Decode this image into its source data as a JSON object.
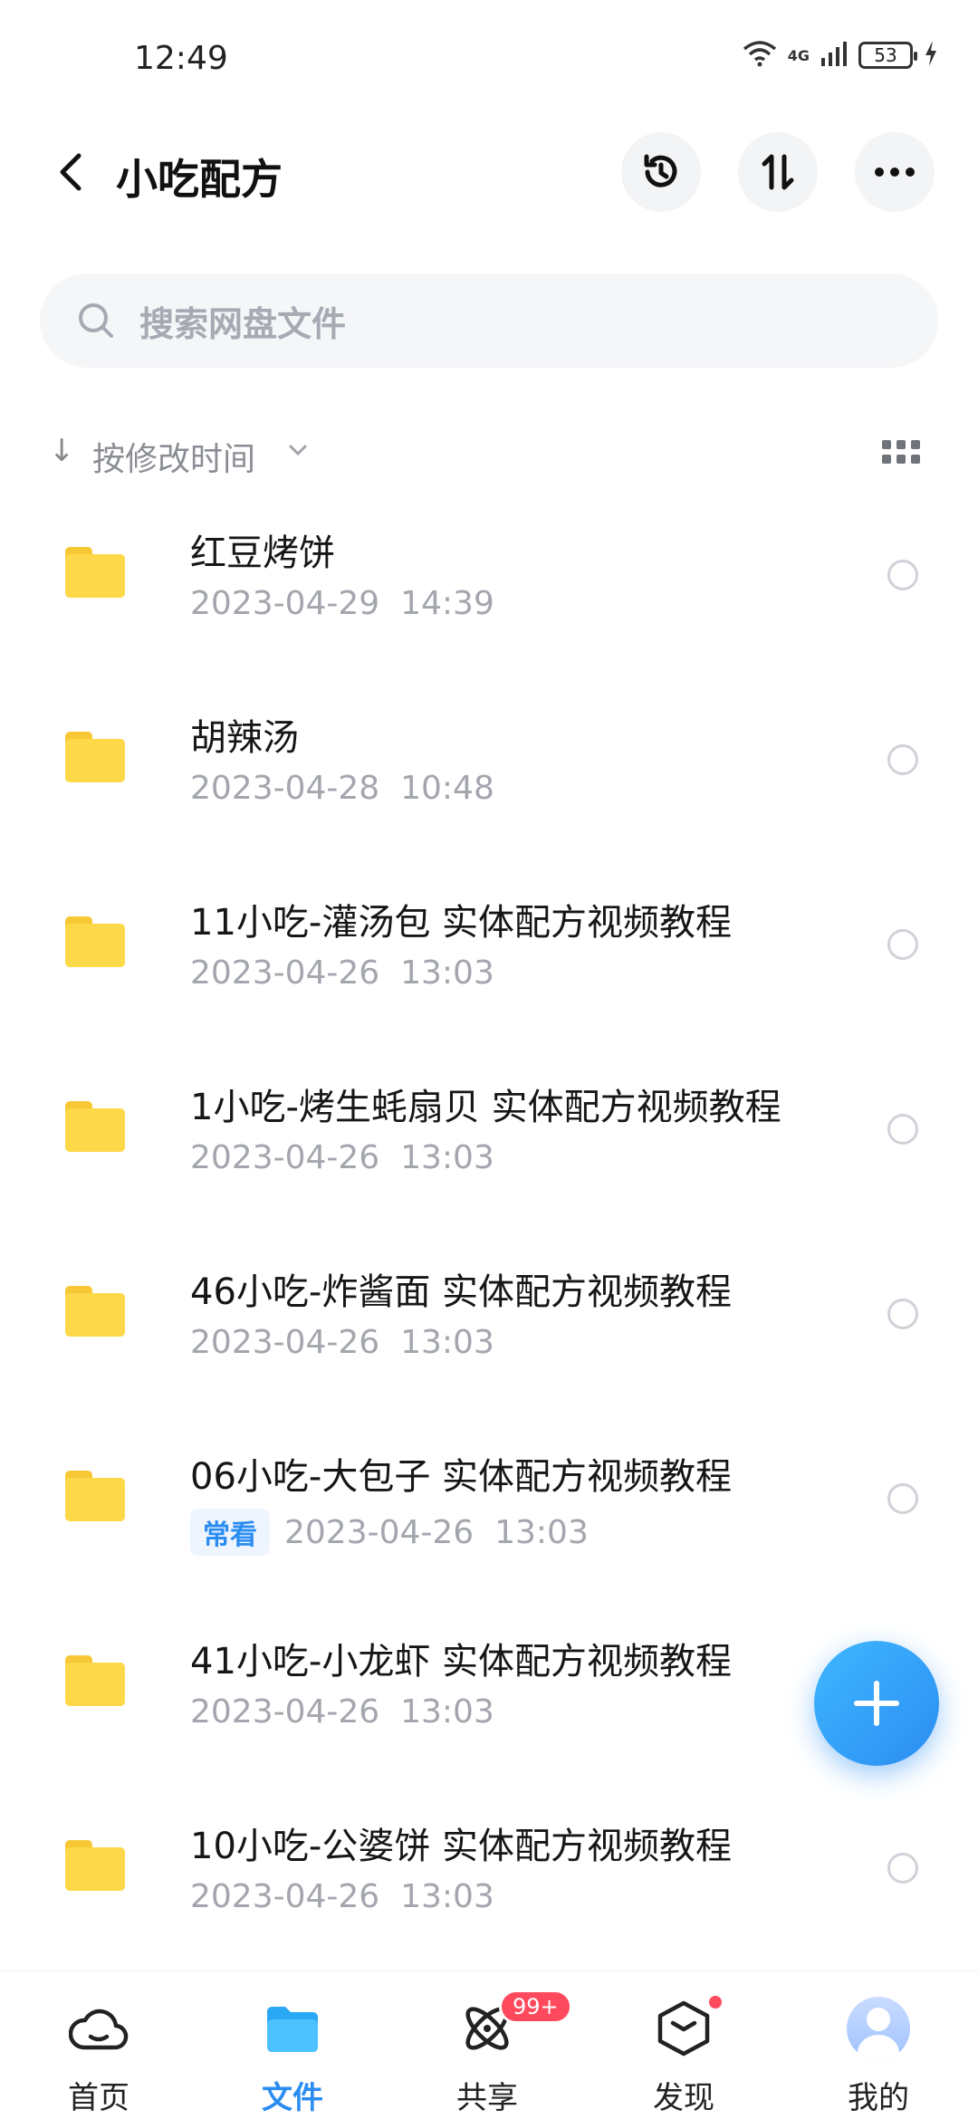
{
  "status_bar": {
    "time": "12:49",
    "battery": "53",
    "network": "4G"
  },
  "header": {
    "title": "小吃配方"
  },
  "search": {
    "placeholder": "搜索网盘文件"
  },
  "sort": {
    "label": "按修改时间"
  },
  "files": [
    {
      "name": "红豆烤饼",
      "date": "2023-04-29  14:39",
      "tag": null
    },
    {
      "name": "胡辣汤",
      "date": "2023-04-28  10:48",
      "tag": null
    },
    {
      "name": "11小吃-灌汤包  实体配方视频教程",
      "date": "2023-04-26  13:03",
      "tag": null
    },
    {
      "name": "1小吃-烤生蚝扇贝  实体配方视频教程",
      "date": "2023-04-26  13:03",
      "tag": null
    },
    {
      "name": "46小吃-炸酱面  实体配方视频教程",
      "date": "2023-04-26  13:03",
      "tag": null
    },
    {
      "name": "06小吃-大包子  实体配方视频教程",
      "date": "2023-04-26  13:03",
      "tag": "常看"
    },
    {
      "name": "41小吃-小龙虾  实体配方视频教程",
      "date": "2023-04-26  13:03",
      "tag": null
    },
    {
      "name": "10小吃-公婆饼  实体配方视频教程",
      "date": "2023-04-26  13:03",
      "tag": null
    }
  ],
  "bottom_nav": {
    "home": "首页",
    "files": "文件",
    "share": "共享",
    "share_badge": "99+",
    "discover": "发现",
    "mine": "我的"
  },
  "colors": {
    "accent": "#2b8df2",
    "folder": "#fdd848",
    "badge": "#ff4a5e"
  }
}
